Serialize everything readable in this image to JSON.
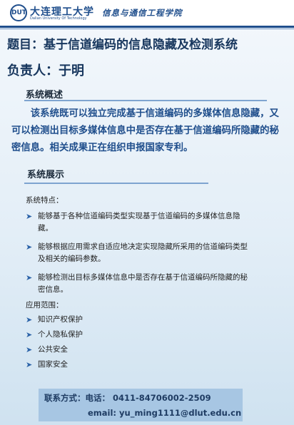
{
  "header": {
    "logo_glyph": "DUT",
    "university_name": "大连理工大学",
    "university_en": "Dalian University Of Technology",
    "school": "信息与通信工程学院"
  },
  "title": {
    "project_line": "题目：基于信道编码的信息隐藏及检测系统",
    "owner_line": "负责人：于明"
  },
  "overview": {
    "heading": "系统概述",
    "text": "该系统既可以独立完成基于信道编码的多媒体信息隐藏，又可以检测出目标多媒体信息中是否存在基于信道编码所隐藏的秘密信息。相关成果正在组织申报国家专利。"
  },
  "showcase": {
    "heading": "系统展示",
    "features_label": "系统特点：",
    "features": [
      "能够基于各种信道编码类型实现基于信道编码的多媒体信息隐藏。",
      "能够根据应用需求自适应地决定实现隐藏所采用的信道编码类型及相关的编码参数。",
      "能够检测出目标多媒体信息中是否存在基于信道编码所隐藏的秘密信息。"
    ],
    "applications_label": "应用范围：",
    "applications": [
      "知识产权保护",
      "个人隐私保护",
      "公共安全",
      "国家安全"
    ],
    "bullet_icon": "arrow-right-icon"
  },
  "contact": {
    "label": "联系方式：",
    "phone_label": "电话：",
    "phone": "0411-84706002-2509",
    "email_label": "email:",
    "email": "yu_ming1111@dlut.edu.cn"
  },
  "colors": {
    "brand": "#1f4e8c",
    "body_text": "#222222",
    "contact_bg": "#a7c6e3"
  }
}
